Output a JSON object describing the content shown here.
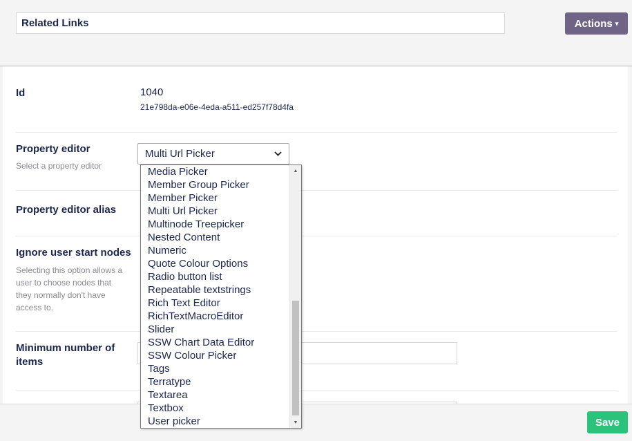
{
  "header": {
    "name_value": "Related Links",
    "actions_label": "Actions",
    "actions_caret": "▾"
  },
  "fields": {
    "id": {
      "label": "Id",
      "number": "1040",
      "guid": "21e798da-e06e-4eda-a511-ed257f78d4fa"
    },
    "property_editor": {
      "label": "Property editor",
      "description": "Select a property editor",
      "selected": "Multi Url Picker"
    },
    "alias": {
      "label": "Property editor alias"
    },
    "ignore_start_nodes": {
      "label": "Ignore user start nodes",
      "description": "Selecting this option allows a user to choose nodes that they normally don't have access to."
    },
    "min_items": {
      "label": "Minimum number of items"
    }
  },
  "dropdown_options": [
    "Media Picker",
    "Member Group Picker",
    "Member Picker",
    "Multi Url Picker",
    "Multinode Treepicker",
    "Nested Content",
    "Numeric",
    "Quote Colour Options",
    "Radio button list",
    "Repeatable textstrings",
    "Rich Text Editor",
    "RichTextMacroEditor",
    "Slider",
    "SSW Chart Data Editor",
    "SSW Colour Picker",
    "Tags",
    "Terratype",
    "Textarea",
    "Textbox",
    "User picker"
  ],
  "footer": {
    "save_label": "Save"
  },
  "colors": {
    "actions_bg": "#6f6386",
    "save_bg": "#2bc37c",
    "text": "#1b264f"
  }
}
